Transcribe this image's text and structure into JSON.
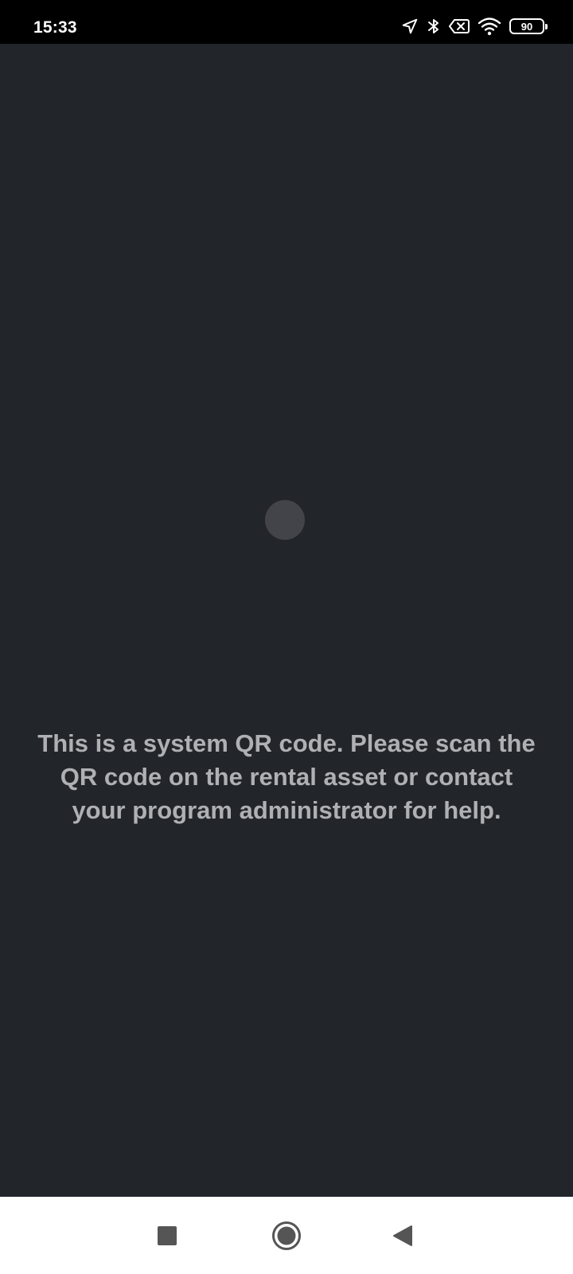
{
  "status_bar": {
    "time": "15:33",
    "battery_level": "90",
    "icons": [
      "location-arrow-icon",
      "bluetooth-icon",
      "no-sim-icon",
      "wifi-icon",
      "battery-icon"
    ]
  },
  "main": {
    "message": "This is a system QR code. Please scan the QR code on the rental asset or contact your program administrator for help."
  },
  "nav_bar": {
    "buttons": [
      "recents",
      "home",
      "back"
    ]
  },
  "colors": {
    "background": "#22252a",
    "status_bar": "#000000",
    "message_text": "#aeb0b3",
    "spinner": "#424449",
    "nav_bar": "#ffffff"
  }
}
